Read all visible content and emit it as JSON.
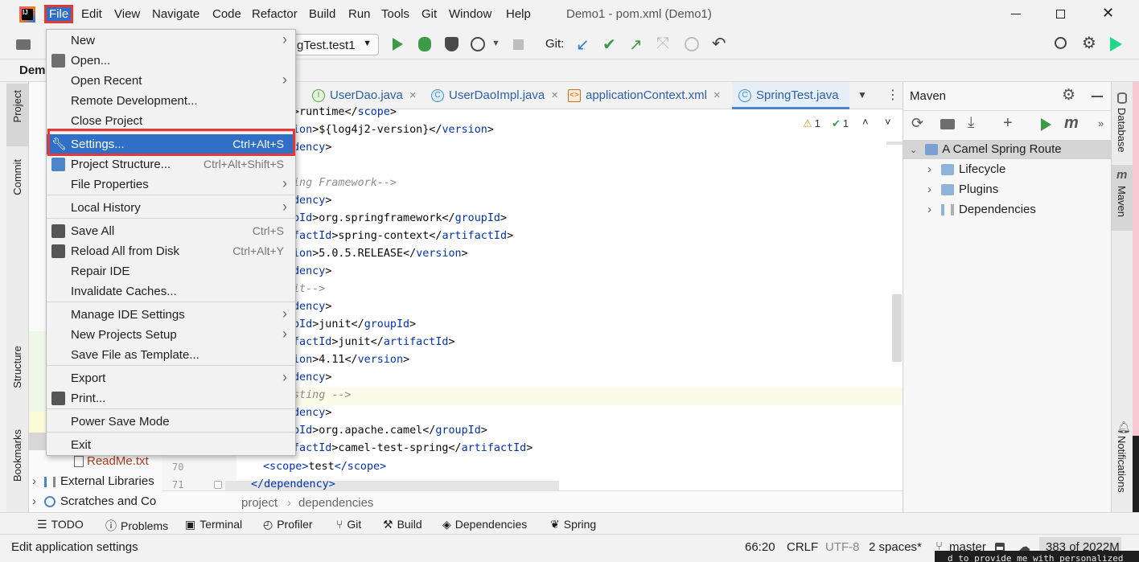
{
  "menubar": {
    "items": [
      "File",
      "Edit",
      "View",
      "Navigate",
      "Code",
      "Refactor",
      "Build",
      "Run",
      "Tools",
      "Git",
      "Window",
      "Help"
    ],
    "title": "Demo1 - pom.xml (Demo1)"
  },
  "toolbar": {
    "run_config": "gTest.test1",
    "git_label": "Git:"
  },
  "nav": {
    "project_crumb": "Dem"
  },
  "left_strip": {
    "project": "Project",
    "commit": "Commit",
    "structure": "Structure",
    "bookmarks": "Bookmarks"
  },
  "right_strip": {
    "database": "Database",
    "maven": "Maven",
    "notifications": "Notifications"
  },
  "tabs": [
    "UserDao.java",
    "UserDaoImpl.java",
    "applicationContext.xml",
    "SpringTest.java"
  ],
  "inspections": {
    "warnings": "1",
    "ok": "1"
  },
  "code": [
    {
      "pre": ">runtime</",
      "tag": "scope",
      "post": ">",
      "kind": "tagline"
    },
    {
      "pre": "ion>${log4j2-version}</",
      "tag": "version",
      "post": ">",
      "kind": "tagline"
    },
    {
      "pre": "dency>",
      "kind": "plain"
    },
    {
      "pre": "",
      "kind": "blank"
    },
    {
      "pre": "ing Framework-->",
      "kind": "comment"
    },
    {
      "pre": "dency>",
      "kind": "plain"
    },
    {
      "pre": "pId>org.springframework</",
      "tag": "groupId",
      "post": ">",
      "kind": "tagline"
    },
    {
      "pre": "factId>spring-context</",
      "tag": "artifactId",
      "post": ">",
      "kind": "tagline"
    },
    {
      "pre": "ion>5.0.5.RELEASE</",
      "tag": "version",
      "post": ">",
      "kind": "tagline"
    },
    {
      "pre": "dency>",
      "kind": "plain"
    },
    {
      "pre": "it-->",
      "kind": "comment"
    },
    {
      "pre": "dency>",
      "kind": "plain"
    },
    {
      "pre": "pId>junit</",
      "tag": "groupId",
      "post": ">",
      "kind": "tagline"
    },
    {
      "pre": "factId>junit</",
      "tag": "artifactId",
      "post": ">",
      "kind": "tagline"
    },
    {
      "pre": "ion>4.11</",
      "tag": "version",
      "post": ">",
      "kind": "tagline"
    },
    {
      "pre": "dency>",
      "kind": "plain"
    },
    {
      "pre": "sting -->",
      "kind": "comment"
    },
    {
      "pre": "dency>",
      "kind": "plain"
    },
    {
      "pre": "pId>org.apache.camel</",
      "tag": "groupId",
      "post": ">",
      "kind": "tagline"
    },
    {
      "pre": "factId>camel-test-spring</",
      "tag": "artifactId",
      "post": ">",
      "kind": "tagline"
    }
  ],
  "code_tail": {
    "line70_num": "70",
    "line70": "<scope>test</scope>",
    "line71_num": "71",
    "line71": "</dependency>"
  },
  "project_tree": {
    "readme": "ReadMe.txt",
    "ext_libs": "External Libraries",
    "scratches": "Scratches and Co"
  },
  "breadcrumb": [
    "project",
    "dependencies"
  ],
  "maven": {
    "title": "Maven",
    "root": "A Camel Spring Route",
    "children": [
      "Lifecycle",
      "Plugins",
      "Dependencies"
    ]
  },
  "file_menu": {
    "items": [
      {
        "label": "New",
        "arrow": true
      },
      {
        "label": "Open..."
      },
      {
        "label": "Open Recent",
        "arrow": true
      },
      {
        "label": "Remote Development..."
      },
      {
        "label": "Close Project"
      },
      {
        "label": "Settings...",
        "shortcut": "Ctrl+Alt+S",
        "selected": true
      },
      {
        "label": "Project Structure...",
        "shortcut": "Ctrl+Alt+Shift+S"
      },
      {
        "label": "File Properties",
        "arrow": true
      },
      {
        "label": "Local History",
        "arrow": true
      },
      {
        "label": "Save All",
        "shortcut": "Ctrl+S"
      },
      {
        "label": "Reload All from Disk",
        "shortcut": "Ctrl+Alt+Y"
      },
      {
        "label": "Repair IDE"
      },
      {
        "label": "Invalidate Caches..."
      },
      {
        "label": "Manage IDE Settings",
        "arrow": true
      },
      {
        "label": "New Projects Setup",
        "arrow": true
      },
      {
        "label": "Save File as Template..."
      },
      {
        "label": "Export",
        "arrow": true
      },
      {
        "label": "Print..."
      },
      {
        "label": "Power Save Mode"
      },
      {
        "label": "Exit"
      }
    ]
  },
  "tool_windows": [
    "TODO",
    "Problems",
    "Terminal",
    "Profiler",
    "Git",
    "Build",
    "Dependencies",
    "Spring"
  ],
  "status": {
    "message": "Edit application settings",
    "position": "66:20",
    "line_sep": "CRLF",
    "encoding": "UTF-8",
    "indent": "2 spaces*",
    "branch": "master",
    "memory": "383 of 2022M",
    "overlay_text": "d to provide me with personalized"
  },
  "colors": {
    "accent": "#2f6fc7",
    "highlight_box": "#e53935",
    "run_green": "#3d9b47"
  }
}
